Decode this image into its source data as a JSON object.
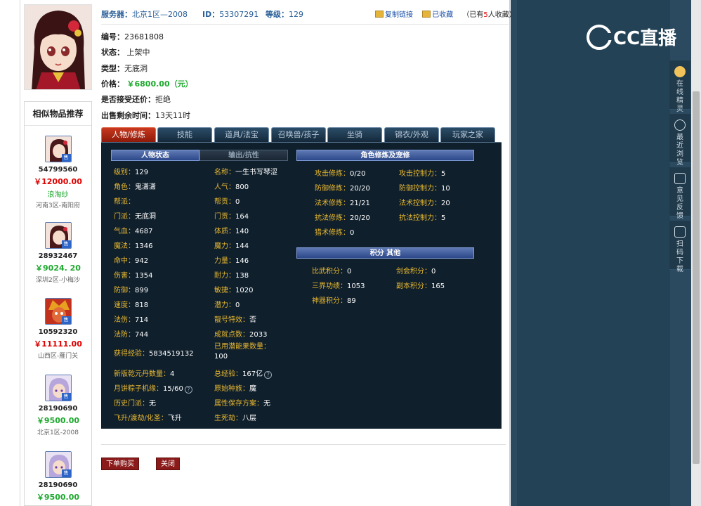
{
  "header": {
    "server_label": "服务器：",
    "server_value": "北京1区—2008",
    "id_label": "ID：",
    "id_value": "53307291",
    "level_label": "等级：",
    "level_value": "129",
    "copy_link": "复制链接",
    "collected": "已收藏",
    "collect_count_prefix": "（已有",
    "collect_count": "5",
    "collect_count_suffix": "人收藏）"
  },
  "info": {
    "number_label": "编号：",
    "number_value": "23681808",
    "status_label": "状态：",
    "status_value": "上架中",
    "type_label": "类型：",
    "type_value": "无底洞",
    "price_label": "价格：",
    "price_value": "￥6800.00（元）",
    "bargain_label": "是否接受还价：",
    "bargain_value": "拒绝",
    "remain_label": "出售剩余时间：",
    "remain_value": "13天11时"
  },
  "similar": {
    "title": "相似物品推荐",
    "sell_badge": "售",
    "items": [
      {
        "id": "54799560",
        "price": "￥12000.00",
        "seller": "浪淘纱",
        "server": "河南3区-南阳府",
        "price_color": "red"
      },
      {
        "id": "28932467",
        "price": "￥9024. 20",
        "seller": "",
        "server": "深圳2区-小梅沙",
        "price_color": "green"
      },
      {
        "id": "10592320",
        "price": "￥11111.00",
        "seller": "",
        "server": "山西区-雁门关",
        "price_color": "red"
      },
      {
        "id": "28190690",
        "price": "￥9500.00",
        "seller": "",
        "server": "北京1区-2008",
        "price_color": "green"
      },
      {
        "id": "28190690",
        "price": "￥9500.00",
        "seller": "",
        "server": "",
        "price_color": "green"
      }
    ]
  },
  "tabs": [
    "人物/修炼",
    "技能",
    "道具/法宝",
    "召唤兽/孩子",
    "坐骑",
    "锦衣/外观",
    "玩家之家"
  ],
  "panel": {
    "head_status": "人物状态",
    "head_output": "输出/抗性",
    "head_cultivation": "角色修炼及宠修",
    "head_points": "积分 其他",
    "left": [
      {
        "k": "级别：",
        "v": "129"
      },
      {
        "k": "角色：",
        "v": "鬼潇潇"
      },
      {
        "k": "帮派：",
        "v": ""
      },
      {
        "k": "门派：",
        "v": "无底洞"
      },
      {
        "k": "气血：",
        "v": "4687"
      },
      {
        "k": "魔法：",
        "v": "1346"
      },
      {
        "k": "命中：",
        "v": "942"
      },
      {
        "k": "伤害：",
        "v": "1354"
      },
      {
        "k": "防御：",
        "v": "899"
      },
      {
        "k": "速度：",
        "v": "818"
      },
      {
        "k": "法伤：",
        "v": "714"
      },
      {
        "k": "法防：",
        "v": "744"
      }
    ],
    "mid": [
      {
        "k": "名称：",
        "v": "一生书写琴涩"
      },
      {
        "k": "人气：",
        "v": "800"
      },
      {
        "k": "帮贡：",
        "v": "0"
      },
      {
        "k": "门贡：",
        "v": "164"
      },
      {
        "k": "体质：",
        "v": "140"
      },
      {
        "k": "魔力：",
        "v": "144"
      },
      {
        "k": "力量：",
        "v": "146"
      },
      {
        "k": "耐力：",
        "v": "138"
      },
      {
        "k": "敏捷：",
        "v": "1020"
      },
      {
        "k": "潜力：",
        "v": "0"
      },
      {
        "k": "靓号特效：",
        "v": "否"
      },
      {
        "k": "成就点数：",
        "v": "2033"
      }
    ],
    "exp": {
      "k": "获得经验：",
      "v": "5834519132"
    },
    "potential_fruit": {
      "k": "已用潜能果数量：",
      "v": "100"
    },
    "bottom_left": [
      {
        "k": "新版乾元丹数量：",
        "v": "4"
      },
      {
        "k": "月饼粽子机缘：",
        "v": "15/60"
      },
      {
        "k": "历史门派：",
        "v": "无"
      },
      {
        "k": "飞升/渡劫/化圣：",
        "v": "飞升"
      }
    ],
    "bottom_mid": [
      {
        "k": "总经验：",
        "v": "167亿"
      },
      {
        "k": "原始种族：",
        "v": "魔"
      },
      {
        "k": "属性保存方案：",
        "v": "无"
      },
      {
        "k": "生死劫：",
        "v": "八层"
      }
    ],
    "cultivation_a": [
      {
        "k": "攻击修炼：",
        "v": "0/20"
      },
      {
        "k": "防御修炼：",
        "v": "20/20"
      },
      {
        "k": "法术修炼：",
        "v": "21/21"
      },
      {
        "k": "抗法修炼：",
        "v": "20/20"
      },
      {
        "k": "猎术修炼：",
        "v": "0"
      }
    ],
    "cultivation_b": [
      {
        "k": "攻击控制力：",
        "v": "5"
      },
      {
        "k": "防御控制力：",
        "v": "10"
      },
      {
        "k": "法术控制力：",
        "v": "20"
      },
      {
        "k": "抗法控制力：",
        "v": "5"
      }
    ],
    "points_a": [
      {
        "k": "比武积分：",
        "v": "0"
      },
      {
        "k": "三界功绩：",
        "v": "1053"
      },
      {
        "k": "神器积分：",
        "v": "89"
      }
    ],
    "points_b": [
      {
        "k": "剑会积分：",
        "v": "0"
      },
      {
        "k": "副本积分：",
        "v": "165"
      }
    ],
    "help_glyph": "?"
  },
  "actions": {
    "buy": "下单购买",
    "close": "关闭"
  },
  "cc": {
    "logo_text": "CC直播",
    "tools": [
      {
        "label": "在线精灵",
        "icon": "mascot-icon"
      },
      {
        "label": "最近浏览",
        "icon": "clock-icon"
      },
      {
        "label": "意见反馈",
        "icon": "edit-icon"
      },
      {
        "label": "扫码下载",
        "icon": "qr-scan-icon"
      }
    ]
  }
}
